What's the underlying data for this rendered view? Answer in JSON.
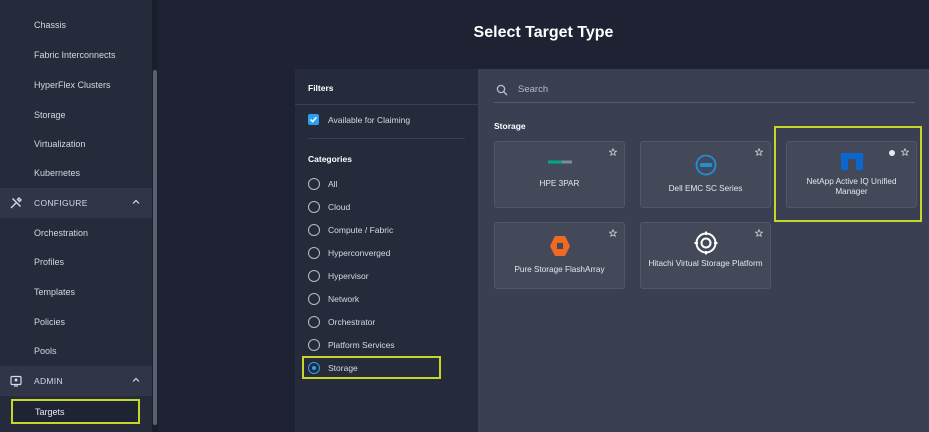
{
  "sidebar": {
    "items_top": [
      "Chassis",
      "Fabric Interconnects",
      "HyperFlex Clusters",
      "Storage",
      "Virtualization",
      "Kubernetes"
    ],
    "configure_label": "CONFIGURE",
    "configure_items": [
      "Orchestration",
      "Profiles",
      "Templates",
      "Policies",
      "Pools"
    ],
    "admin_label": "ADMIN",
    "admin_items": [
      "Targets"
    ]
  },
  "header": {
    "title": "Select Target Type"
  },
  "filters": {
    "heading": "Filters",
    "available_label": "Available for Claiming",
    "available_checked": true,
    "categories_heading": "Categories",
    "categories": [
      "All",
      "Cloud",
      "Compute / Fabric",
      "Hyperconverged",
      "Hypervisor",
      "Network",
      "Orchestrator",
      "Platform Services",
      "Storage"
    ],
    "selected_category": "Storage"
  },
  "search": {
    "placeholder": "Search",
    "value": ""
  },
  "section_title": "Storage",
  "cards": [
    {
      "name": "HPE 3PAR",
      "icon": "hpe-logo-icon"
    },
    {
      "name": "Dell EMC SC Series",
      "icon": "dell-logo-icon"
    },
    {
      "name": "NetApp Active IQ Unified Manager",
      "icon": "netapp-logo-icon"
    },
    {
      "name": "Pure Storage FlashArray",
      "icon": "pure-storage-logo-icon"
    },
    {
      "name": "Hitachi Virtual Storage Platform",
      "icon": "hitachi-logo-icon"
    }
  ],
  "colors": {
    "highlight": "#c8d62a",
    "accent": "#2b9ff0",
    "netapp_blue": "#0a67d0",
    "pure_orange": "#f06a23"
  }
}
